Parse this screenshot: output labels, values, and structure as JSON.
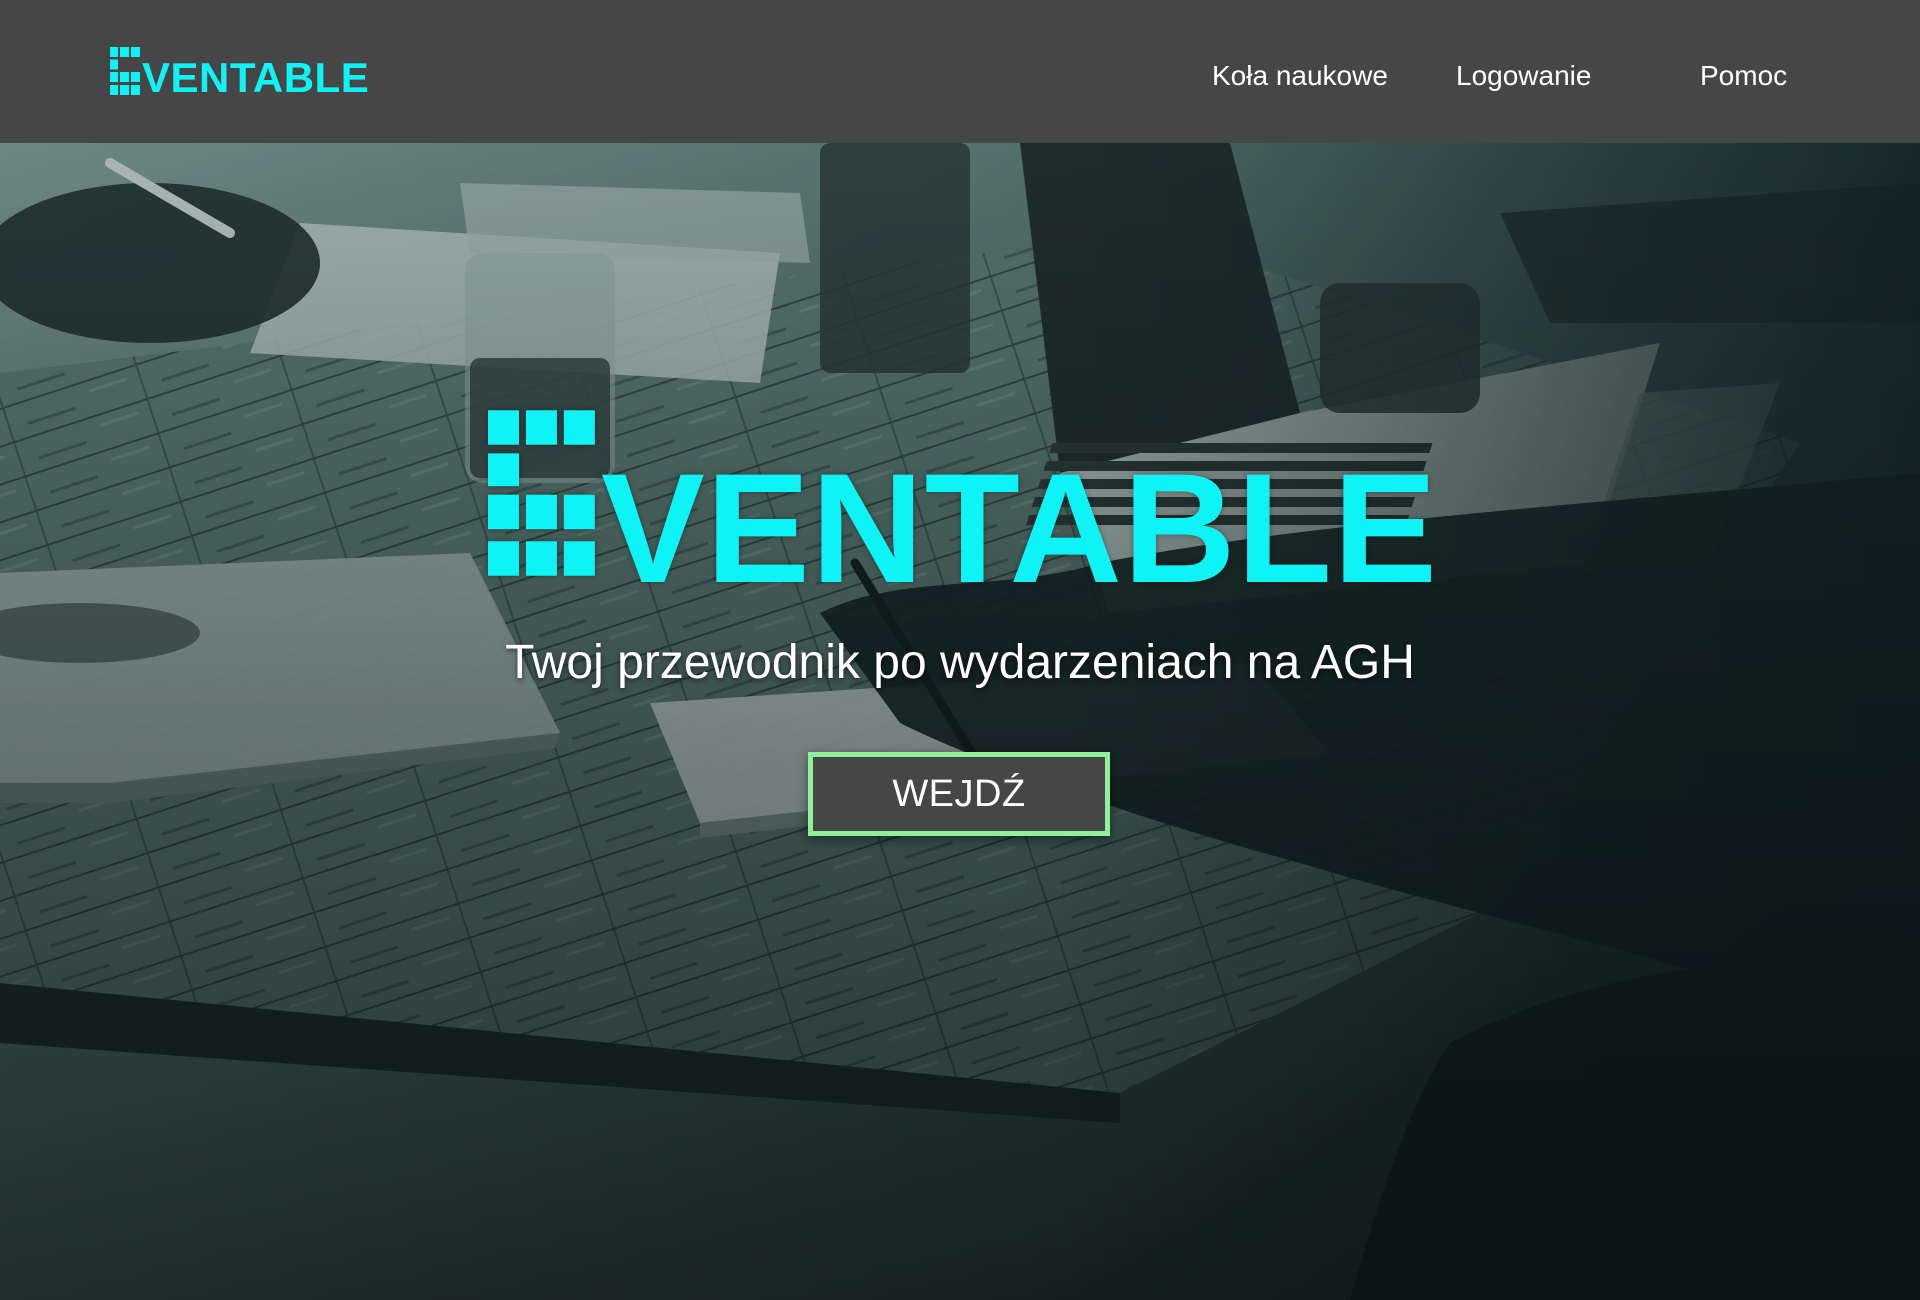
{
  "header": {
    "brand": "VENTABLE",
    "nav": [
      {
        "label": "Koła naukowe"
      },
      {
        "label": "Logowanie"
      },
      {
        "label": "Pomoc"
      }
    ]
  },
  "hero": {
    "title": "VENTABLE",
    "tagline": "Twoj przewodnik po wydarzeniach na AGH",
    "cta_label": "WEJDŹ"
  },
  "colors": {
    "accent": "#0ef4f6",
    "topbar": "#464646",
    "button_border": "#8ff09a",
    "button_bg": "#464646",
    "text": "#ffffff"
  }
}
